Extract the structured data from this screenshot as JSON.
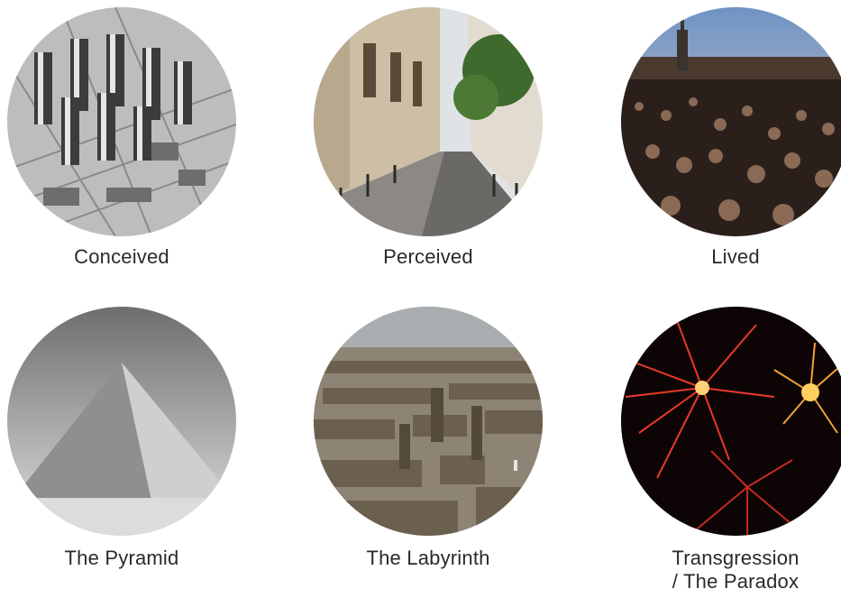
{
  "tiles": [
    {
      "label": "Conceived",
      "image": "city-model-photo"
    },
    {
      "label": "Perceived",
      "image": "paris-street-photo"
    },
    {
      "label": "Lived",
      "image": "crowd-square-photo"
    },
    {
      "label": "The Pyramid",
      "image": "pyramid-photo"
    },
    {
      "label": "The Labyrinth",
      "image": "labyrinth-photo"
    },
    {
      "label": "Transgression",
      "label_line2": "/ The Paradox",
      "image": "fireworks-photo"
    }
  ]
}
